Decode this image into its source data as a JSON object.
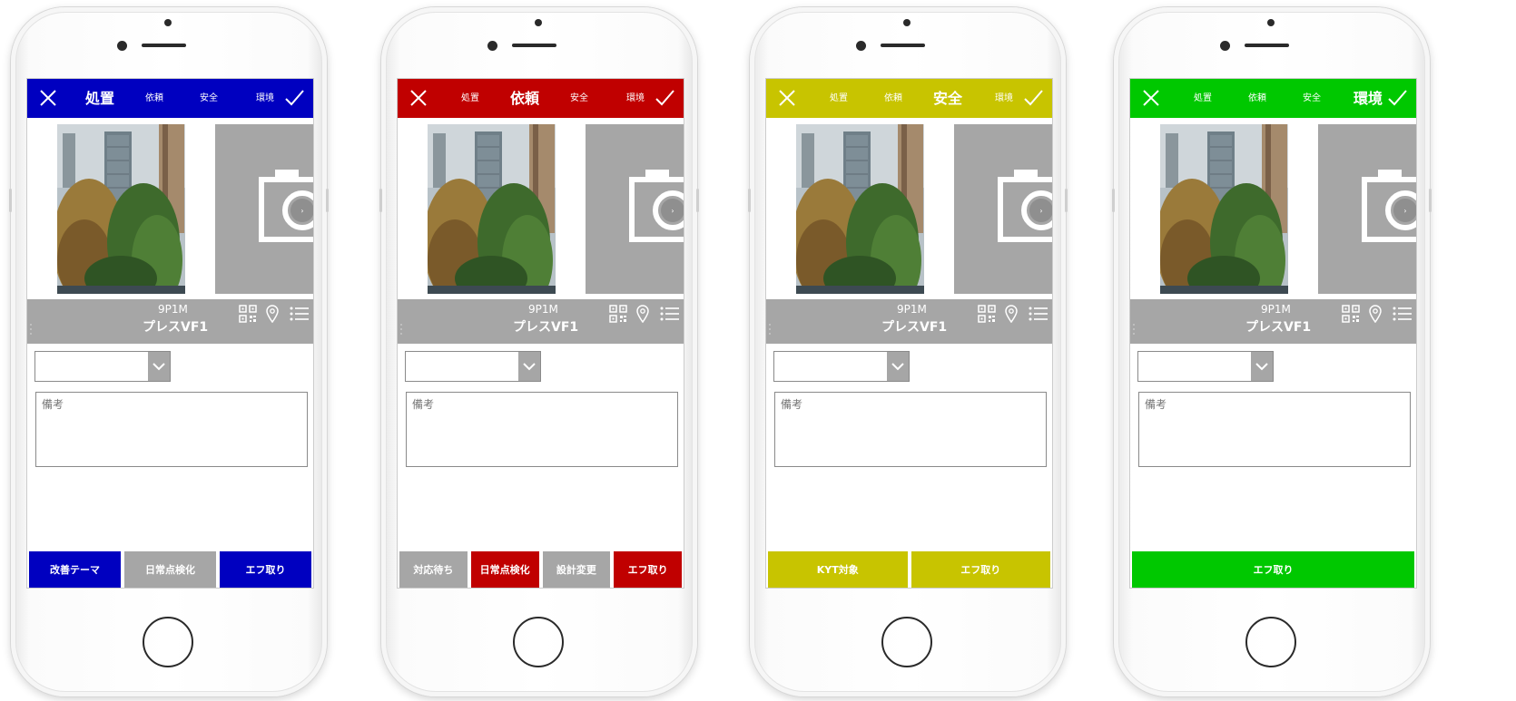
{
  "colors": {
    "primary": "#0000c0",
    "secondary": "#c00000",
    "tertiary": "#c8c400",
    "quaternary": "#00c800",
    "gray_button": "#a6a6a6",
    "screen_gray": "#a6a6a6"
  },
  "icons": {
    "close": "close-icon",
    "confirm": "checkmark-icon",
    "camera": "camera-icon",
    "qr": "qr-code-icon",
    "location": "location-pin-icon",
    "list": "list-icon",
    "dropdown": "chevron-down-icon"
  },
  "phones": [
    {
      "accent": "#0000c0",
      "tabs": [
        {
          "label": "処置",
          "active": true
        },
        {
          "label": "依頼",
          "active": false
        },
        {
          "label": "安全",
          "active": false
        },
        {
          "label": "環境",
          "active": false
        }
      ],
      "code": "9P1M",
      "name": "プレスVF1",
      "remarks_placeholder": "備考",
      "actions": [
        {
          "label": "改善テーマ",
          "color": "#0000c0"
        },
        {
          "label": "日常点検化",
          "color": "#a6a6a6"
        },
        {
          "label": "エフ取り",
          "color": "#0000c0"
        }
      ]
    },
    {
      "accent": "#c00000",
      "tabs": [
        {
          "label": "処置",
          "active": false
        },
        {
          "label": "依頼",
          "active": true
        },
        {
          "label": "安全",
          "active": false
        },
        {
          "label": "環境",
          "active": false
        }
      ],
      "code": "9P1M",
      "name": "プレスVF1",
      "remarks_placeholder": "備考",
      "actions": [
        {
          "label": "対応待ち",
          "color": "#a6a6a6"
        },
        {
          "label": "日常点検化",
          "color": "#c00000"
        },
        {
          "label": "設計変更",
          "color": "#a6a6a6"
        },
        {
          "label": "エフ取り",
          "color": "#c00000"
        }
      ]
    },
    {
      "accent": "#c8c400",
      "tabs": [
        {
          "label": "処置",
          "active": false
        },
        {
          "label": "依頼",
          "active": false
        },
        {
          "label": "安全",
          "active": true
        },
        {
          "label": "環境",
          "active": false
        }
      ],
      "code": "9P1M",
      "name": "プレスVF1",
      "remarks_placeholder": "備考",
      "actions": [
        {
          "label": "KYT対象",
          "color": "#c8c400"
        },
        {
          "label": "エフ取り",
          "color": "#c8c400"
        }
      ]
    },
    {
      "accent": "#00c800",
      "tabs": [
        {
          "label": "処置",
          "active": false
        },
        {
          "label": "依頼",
          "active": false
        },
        {
          "label": "安全",
          "active": false
        },
        {
          "label": "環境",
          "active": true
        }
      ],
      "code": "9P1M",
      "name": "プレスVF1",
      "remarks_placeholder": "備考",
      "actions": [
        {
          "label": "エフ取り",
          "color": "#00c800"
        }
      ]
    }
  ]
}
